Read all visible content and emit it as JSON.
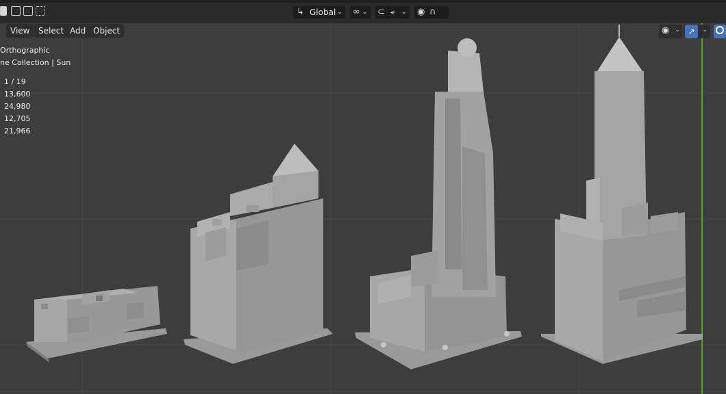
{
  "header": {
    "transform_orientation": "Global"
  },
  "viewport_menu": {
    "view": "View",
    "select": "Select",
    "add": "Add",
    "object": "Object"
  },
  "overlay": {
    "view_mode": "Orthographic",
    "collection_info": "ne Collection | Sun",
    "stats": [
      "1 / 19",
      "13,600",
      "24,980",
      "12,705",
      "21,966"
    ]
  },
  "icons": {
    "select_modes": [
      "select-box-icon",
      "select-extend-icon",
      "select-subtract-icon"
    ],
    "orientation": "transform-orientation-icon",
    "pivot": "pivot-point-icon",
    "snap": "snap-magnet-icon",
    "snap_target": "snap-increment-icon",
    "proportional": "proportional-editing-icon",
    "falloff": "falloff-curve-icon",
    "visibility": "eye-icon",
    "gizmo": "gizmo-arrow-icon",
    "overlay": "overlays-icon"
  },
  "colors": {
    "background": "#3d3d3d",
    "header": "#2b2b2b",
    "grid": "#474747",
    "axis_y": "#5f9a2b",
    "accent": "#4772b3",
    "building_light": "#a0a0a0",
    "building_dark": "#888888"
  }
}
